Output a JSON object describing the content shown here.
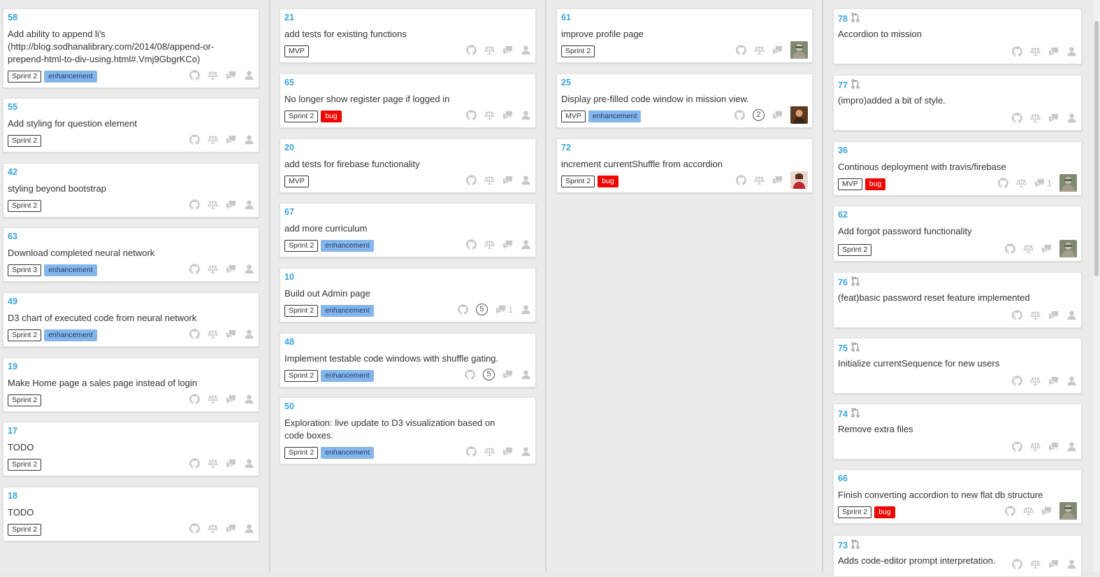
{
  "colors": {
    "number": "#3aa3dc",
    "icon_gray": "#c8c8c8",
    "label_enhancement": "#84b6eb",
    "label_bug": "#ee0701"
  },
  "columns": [
    {
      "cards": [
        {
          "number": "58",
          "title": "Add ability to append li's (http://blog.sodhanalibrary.com/2014/08/append-or-prepend-html-to-div-using.html#.Vmj9GbgrKCo)",
          "labels": [
            {
              "text": "Sprint 2",
              "kind": "plain"
            },
            {
              "text": "enhancement",
              "kind": "enhancement"
            }
          ],
          "avatar": null,
          "badge": null,
          "comments": null,
          "pr": false
        },
        {
          "number": "55",
          "title": "Add styling for question element",
          "labels": [
            {
              "text": "Sprint 2",
              "kind": "plain"
            }
          ],
          "avatar": null,
          "badge": null,
          "comments": null,
          "pr": false
        },
        {
          "number": "42",
          "title": "styling beyond bootstrap",
          "labels": [
            {
              "text": "Sprint 2",
              "kind": "plain"
            }
          ],
          "avatar": null,
          "badge": null,
          "comments": null,
          "pr": false
        },
        {
          "number": "63",
          "title": "Download completed neural network",
          "labels": [
            {
              "text": "Sprint 3",
              "kind": "plain"
            },
            {
              "text": "enhancement",
              "kind": "enhancement"
            }
          ],
          "avatar": null,
          "badge": null,
          "comments": null,
          "pr": false
        },
        {
          "number": "49",
          "title": "D3 chart of executed code from neural network",
          "labels": [
            {
              "text": "Sprint 2",
              "kind": "plain"
            },
            {
              "text": "enhancement",
              "kind": "enhancement"
            }
          ],
          "avatar": null,
          "badge": null,
          "comments": null,
          "pr": false
        },
        {
          "number": "19",
          "title": "Make Home page a sales page instead of login",
          "labels": [
            {
              "text": "Sprint 2",
              "kind": "plain"
            }
          ],
          "avatar": null,
          "badge": null,
          "comments": null,
          "pr": false
        },
        {
          "number": "17",
          "title": "TODO",
          "labels": [
            {
              "text": "Sprint 2",
              "kind": "plain"
            }
          ],
          "avatar": null,
          "badge": null,
          "comments": null,
          "pr": false
        },
        {
          "number": "18",
          "title": "TODO",
          "labels": [
            {
              "text": "Sprint 2",
              "kind": "plain"
            }
          ],
          "avatar": null,
          "badge": null,
          "comments": null,
          "pr": false
        }
      ]
    },
    {
      "cards": [
        {
          "number": "21",
          "title": "add tests for existing functions",
          "labels": [
            {
              "text": "MVP",
              "kind": "plain"
            }
          ],
          "avatar": null,
          "badge": null,
          "comments": null,
          "pr": false
        },
        {
          "number": "65",
          "title": "No longer show register page if logged in",
          "labels": [
            {
              "text": "Sprint 2",
              "kind": "plain"
            },
            {
              "text": "bug",
              "kind": "bug"
            }
          ],
          "avatar": null,
          "badge": null,
          "comments": null,
          "pr": false
        },
        {
          "number": "20",
          "title": "add tests for firebase functionality",
          "labels": [
            {
              "text": "MVP",
              "kind": "plain"
            }
          ],
          "avatar": null,
          "badge": null,
          "comments": null,
          "pr": false
        },
        {
          "number": "67",
          "title": "add more curriculum",
          "labels": [
            {
              "text": "Sprint 2",
              "kind": "plain"
            },
            {
              "text": "enhancement",
              "kind": "enhancement"
            }
          ],
          "avatar": null,
          "badge": null,
          "comments": null,
          "pr": false
        },
        {
          "number": "10",
          "title": "Build out Admin page",
          "labels": [
            {
              "text": "Sprint 2",
              "kind": "plain"
            },
            {
              "text": "enhancement",
              "kind": "enhancement"
            }
          ],
          "avatar": null,
          "badge": "5",
          "comments": "1",
          "pr": false
        },
        {
          "number": "48",
          "title": "Implement testable code windows with shuffle gating.",
          "labels": [
            {
              "text": "Sprint 2",
              "kind": "plain"
            },
            {
              "text": "enhancement",
              "kind": "enhancement"
            }
          ],
          "avatar": null,
          "badge": "5",
          "comments": null,
          "pr": false
        },
        {
          "number": "50",
          "title": "Exploration: live update to D3 visualization based on code boxes.",
          "labels": [
            {
              "text": "Sprint 2",
              "kind": "plain"
            },
            {
              "text": "enhancement",
              "kind": "enhancement"
            }
          ],
          "avatar": null,
          "badge": null,
          "comments": null,
          "pr": false
        }
      ]
    },
    {
      "cards": [
        {
          "number": "61",
          "title": "improve profile page",
          "labels": [
            {
              "text": "Sprint 2",
              "kind": "plain"
            }
          ],
          "avatar": "gray",
          "badge": null,
          "comments": null,
          "pr": false
        },
        {
          "number": "25",
          "title": "Display pre-filled code window in mission view.",
          "labels": [
            {
              "text": "MVP",
              "kind": "plain"
            },
            {
              "text": "enhancement",
              "kind": "enhancement"
            }
          ],
          "avatar": "brown",
          "badge": "2",
          "comments": null,
          "pr": false
        },
        {
          "number": "72",
          "title": "increment currentShuffle from accordion",
          "labels": [
            {
              "text": "Sprint 2",
              "kind": "plain"
            },
            {
              "text": "bug",
              "kind": "bug"
            }
          ],
          "avatar": "red",
          "badge": null,
          "comments": null,
          "pr": false
        }
      ]
    },
    {
      "cards": [
        {
          "number": "78",
          "title": "Accordion to mission",
          "labels": [],
          "avatar": null,
          "badge": null,
          "comments": null,
          "pr": true
        },
        {
          "number": "77",
          "title": "(impro)added a bit of style.",
          "labels": [],
          "avatar": null,
          "badge": null,
          "comments": null,
          "pr": true
        },
        {
          "number": "36",
          "title": "Continous deployment with travis/firebase",
          "labels": [
            {
              "text": "MVP",
              "kind": "plain"
            },
            {
              "text": "bug",
              "kind": "bug"
            }
          ],
          "avatar": "gray",
          "badge": null,
          "comments": "1",
          "pr": false
        },
        {
          "number": "62",
          "title": "Add forgot password functionality",
          "labels": [
            {
              "text": "Sprint 2",
              "kind": "plain"
            }
          ],
          "avatar": "gray",
          "badge": null,
          "comments": null,
          "pr": false
        },
        {
          "number": "76",
          "title": "(feat)basic password reset feature implemented",
          "labels": [],
          "avatar": null,
          "badge": null,
          "comments": null,
          "pr": true
        },
        {
          "number": "75",
          "title": "Initialize currentSequence for new users",
          "labels": [],
          "avatar": null,
          "badge": null,
          "comments": null,
          "pr": true
        },
        {
          "number": "74",
          "title": "Remove extra files",
          "labels": [],
          "avatar": null,
          "badge": null,
          "comments": null,
          "pr": true
        },
        {
          "number": "66",
          "title": "Finish converting accordion to new flat db structure",
          "labels": [
            {
              "text": "Sprint 2",
              "kind": "plain"
            },
            {
              "text": "bug",
              "kind": "bug"
            }
          ],
          "avatar": "gray",
          "badge": null,
          "comments": null,
          "pr": false
        },
        {
          "number": "73",
          "title": "Adds code-editor prompt interpretation.",
          "labels": [],
          "avatar": null,
          "badge": null,
          "comments": null,
          "pr": true
        }
      ]
    }
  ]
}
